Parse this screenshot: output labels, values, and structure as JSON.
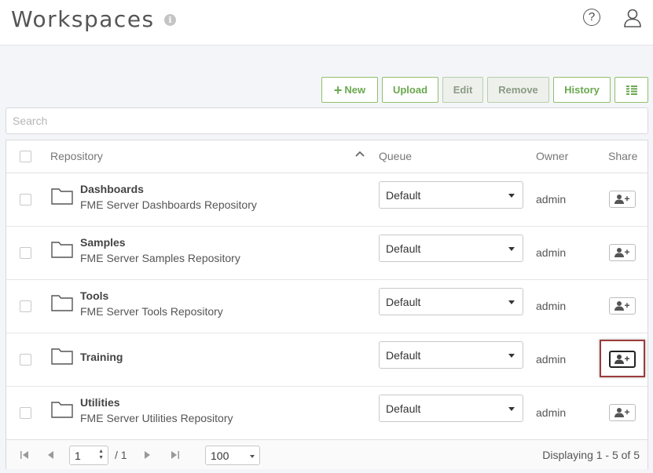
{
  "header": {
    "title": "Workspaces",
    "info_glyph": "i",
    "help_glyph": "?"
  },
  "toolbar": {
    "new_label": "New",
    "upload_label": "Upload",
    "edit_label": "Edit",
    "remove_label": "Remove",
    "history_label": "History"
  },
  "search": {
    "placeholder": "Search",
    "value": ""
  },
  "table": {
    "columns": {
      "repository": "Repository",
      "queue": "Queue",
      "owner": "Owner",
      "share": "Share"
    },
    "rows": [
      {
        "name": "Dashboards",
        "description": "FME Server Dashboards Repository",
        "queue": "Default",
        "owner": "admin"
      },
      {
        "name": "Samples",
        "description": "FME Server Samples Repository",
        "queue": "Default",
        "owner": "admin"
      },
      {
        "name": "Tools",
        "description": "FME Server Tools Repository",
        "queue": "Default",
        "owner": "admin"
      },
      {
        "name": "Training",
        "description": "",
        "queue": "Default",
        "owner": "admin"
      },
      {
        "name": "Utilities",
        "description": "FME Server Utilities Repository",
        "queue": "Default",
        "owner": "admin"
      }
    ]
  },
  "pagination": {
    "page": "1",
    "total_pages": "/ 1",
    "per_page": "100",
    "displaying": "Displaying 1 - 5 of 5"
  },
  "colors": {
    "accent_green": "#6aa84f",
    "highlight_red": "#9c3b3b"
  }
}
